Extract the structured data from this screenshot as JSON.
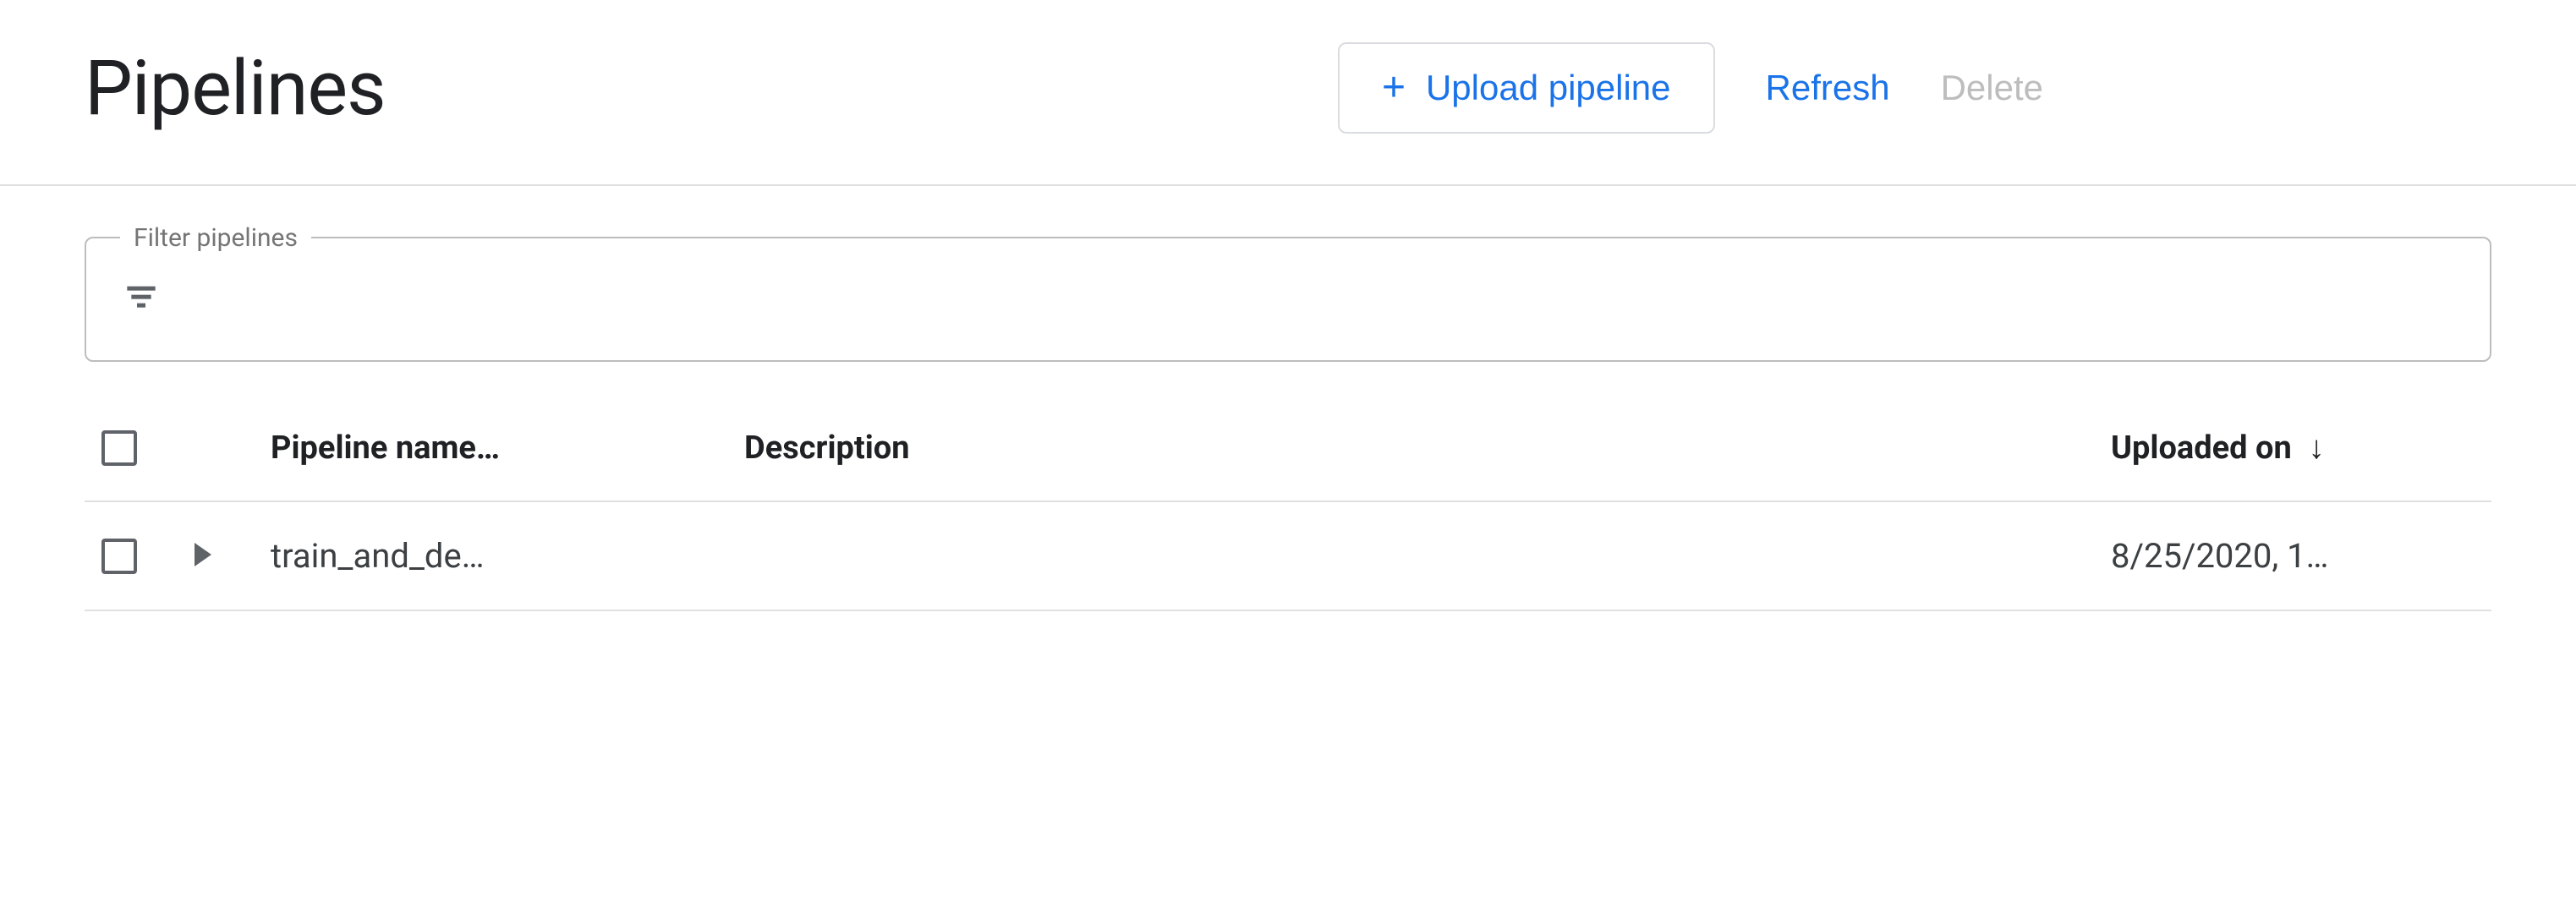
{
  "header": {
    "title": "Pipelines",
    "upload_label": "Upload pipeline",
    "refresh_label": "Refresh",
    "delete_label": "Delete"
  },
  "filter": {
    "label": "Filter pipelines"
  },
  "table": {
    "columns": {
      "name": "Pipeline name…",
      "description": "Description",
      "uploaded": "Uploaded on"
    },
    "rows": [
      {
        "name": "train_and_de…",
        "description": "",
        "uploaded": "8/25/2020, 1…"
      }
    ]
  }
}
